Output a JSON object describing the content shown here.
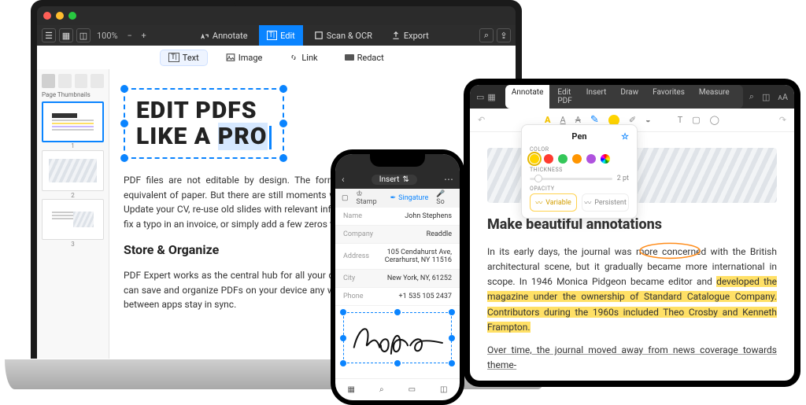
{
  "laptop": {
    "zoom": "100%",
    "top_tabs": {
      "annotate": "Annotate",
      "edit": "Edit",
      "scan": "Scan & OCR",
      "export": "Export"
    },
    "sub_tabs": {
      "text": "Text",
      "image": "Image",
      "link": "Link",
      "redact": "Redact"
    },
    "side_label": "Page Thumbnails",
    "headline_1": "EDIT PDFS",
    "headline_2a": "LIKE A ",
    "headline_2b": "PRO",
    "para1": "PDF files are not editable by design. The format was invented years ago as digital equivalent of paper. But there are still moments when you actually need to edit that PDF: Update your CV, re-use old slides with relevant information, change the address in a lease, fix a typo in an invoice, or simply add a few zeros to a sum.",
    "h2": "Store & Organize",
    "para2": "PDF Expert works as the central hub for all your documents. With PDF Expert for iOS, you can save and organize PDFs on your device any way you want, including folders. All these between apps stay in sync."
  },
  "phone": {
    "title": "Insert",
    "tool_stamp": "Stamp",
    "tool_signature": "Singature",
    "tool_sound": "So",
    "rows": [
      {
        "label": "Name",
        "value": "John Stephens"
      },
      {
        "label": "Company",
        "value": "Readdle"
      },
      {
        "label": "Address",
        "value": "105 Cendahurst Ave,\nCerarhurst, NY 11516"
      },
      {
        "label": "City",
        "value": "New York, NY, 61252"
      },
      {
        "label": "Phone",
        "value": "+1 535 105 2437"
      }
    ]
  },
  "tablet": {
    "tabs": [
      "Annotate",
      "Edit PDF",
      "Insert",
      "Draw",
      "Favorites",
      "Measure"
    ],
    "popover": {
      "title": "Pen",
      "color_label": "COLOR",
      "thickness_label": "THICKNESS",
      "thickness_value": "2 pt",
      "opacity_label": "OPACITY",
      "variable": "Variable",
      "persistent": "Persistent",
      "colors": [
        "#ffd400",
        "#ff3b30",
        "#34c759",
        "#ff9500",
        "#af52de",
        "conic"
      ]
    },
    "heading": "Make beautiful annotations",
    "p1a": "In its early days, the journal was ",
    "p1_circle": "more concerned",
    "p1b": " with the British architectural scene, but it gradually became more international in scope. In 1946 Monica Pidgeon became editor and ",
    "p1_hl": "developed the magazine under the ownership of Standard Catalogue Company. Contributors during the 1960s included Theo Crosby and Kenneth Frampton.",
    "p2": "Over time, the journal moved away from news coverage towards theme-"
  }
}
